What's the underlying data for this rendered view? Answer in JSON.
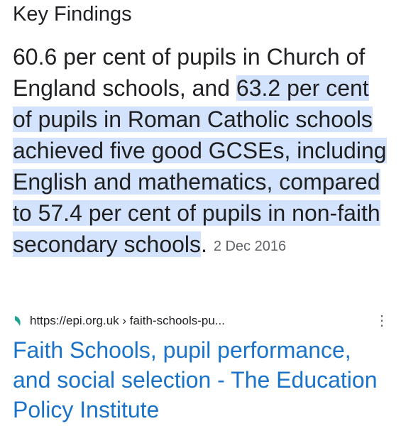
{
  "section": {
    "heading": "Key Findings"
  },
  "snippet": {
    "plain": "60.6 per cent of pupils in Church of England schools, and ",
    "highlighted": "63.2 per cent of pupils in Roman Catholic schools achieved five good GCSEs, including English and mathematics, compared to 57.4 per cent of pupils in non-faith secondary schools",
    "after": ".",
    "date": "2 Dec 2016"
  },
  "result": {
    "favicon": "epi-favicon-icon",
    "url": "https://epi.org.uk › faith-schools-pu...",
    "more_icon": "more-vert-icon",
    "more_glyph": "⋮",
    "title": "Faith Schools, pupil performance, and social selection - The Education Policy Institute"
  },
  "colors": {
    "highlight": "#d3e3fd",
    "link": "#1a73c8",
    "text": "#202124",
    "muted": "#5f6368",
    "favicon": "#1aa38f"
  }
}
